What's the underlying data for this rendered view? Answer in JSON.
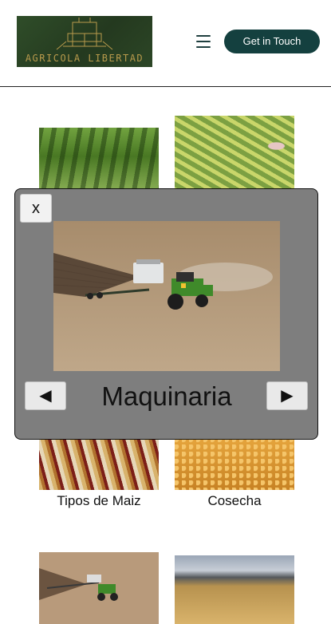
{
  "header": {
    "logo_text": "AGRICOLA LIBERTAD",
    "cta_label": "Get in Touch"
  },
  "gallery": {
    "captions": [
      "Tipos de Maiz",
      "Cosecha"
    ]
  },
  "modal": {
    "close_label": "x",
    "title": "Maquinaria",
    "prev_label": "◀",
    "next_label": "▶"
  },
  "colors": {
    "brand_dark": "#14403f",
    "logo_bg": "#2f4d29",
    "logo_gold": "#b89a4c",
    "modal_bg": "#7e7e7e"
  },
  "icons": [
    "menu-icon",
    "tractor-icon",
    "arrow-left-icon",
    "arrow-right-icon"
  ]
}
